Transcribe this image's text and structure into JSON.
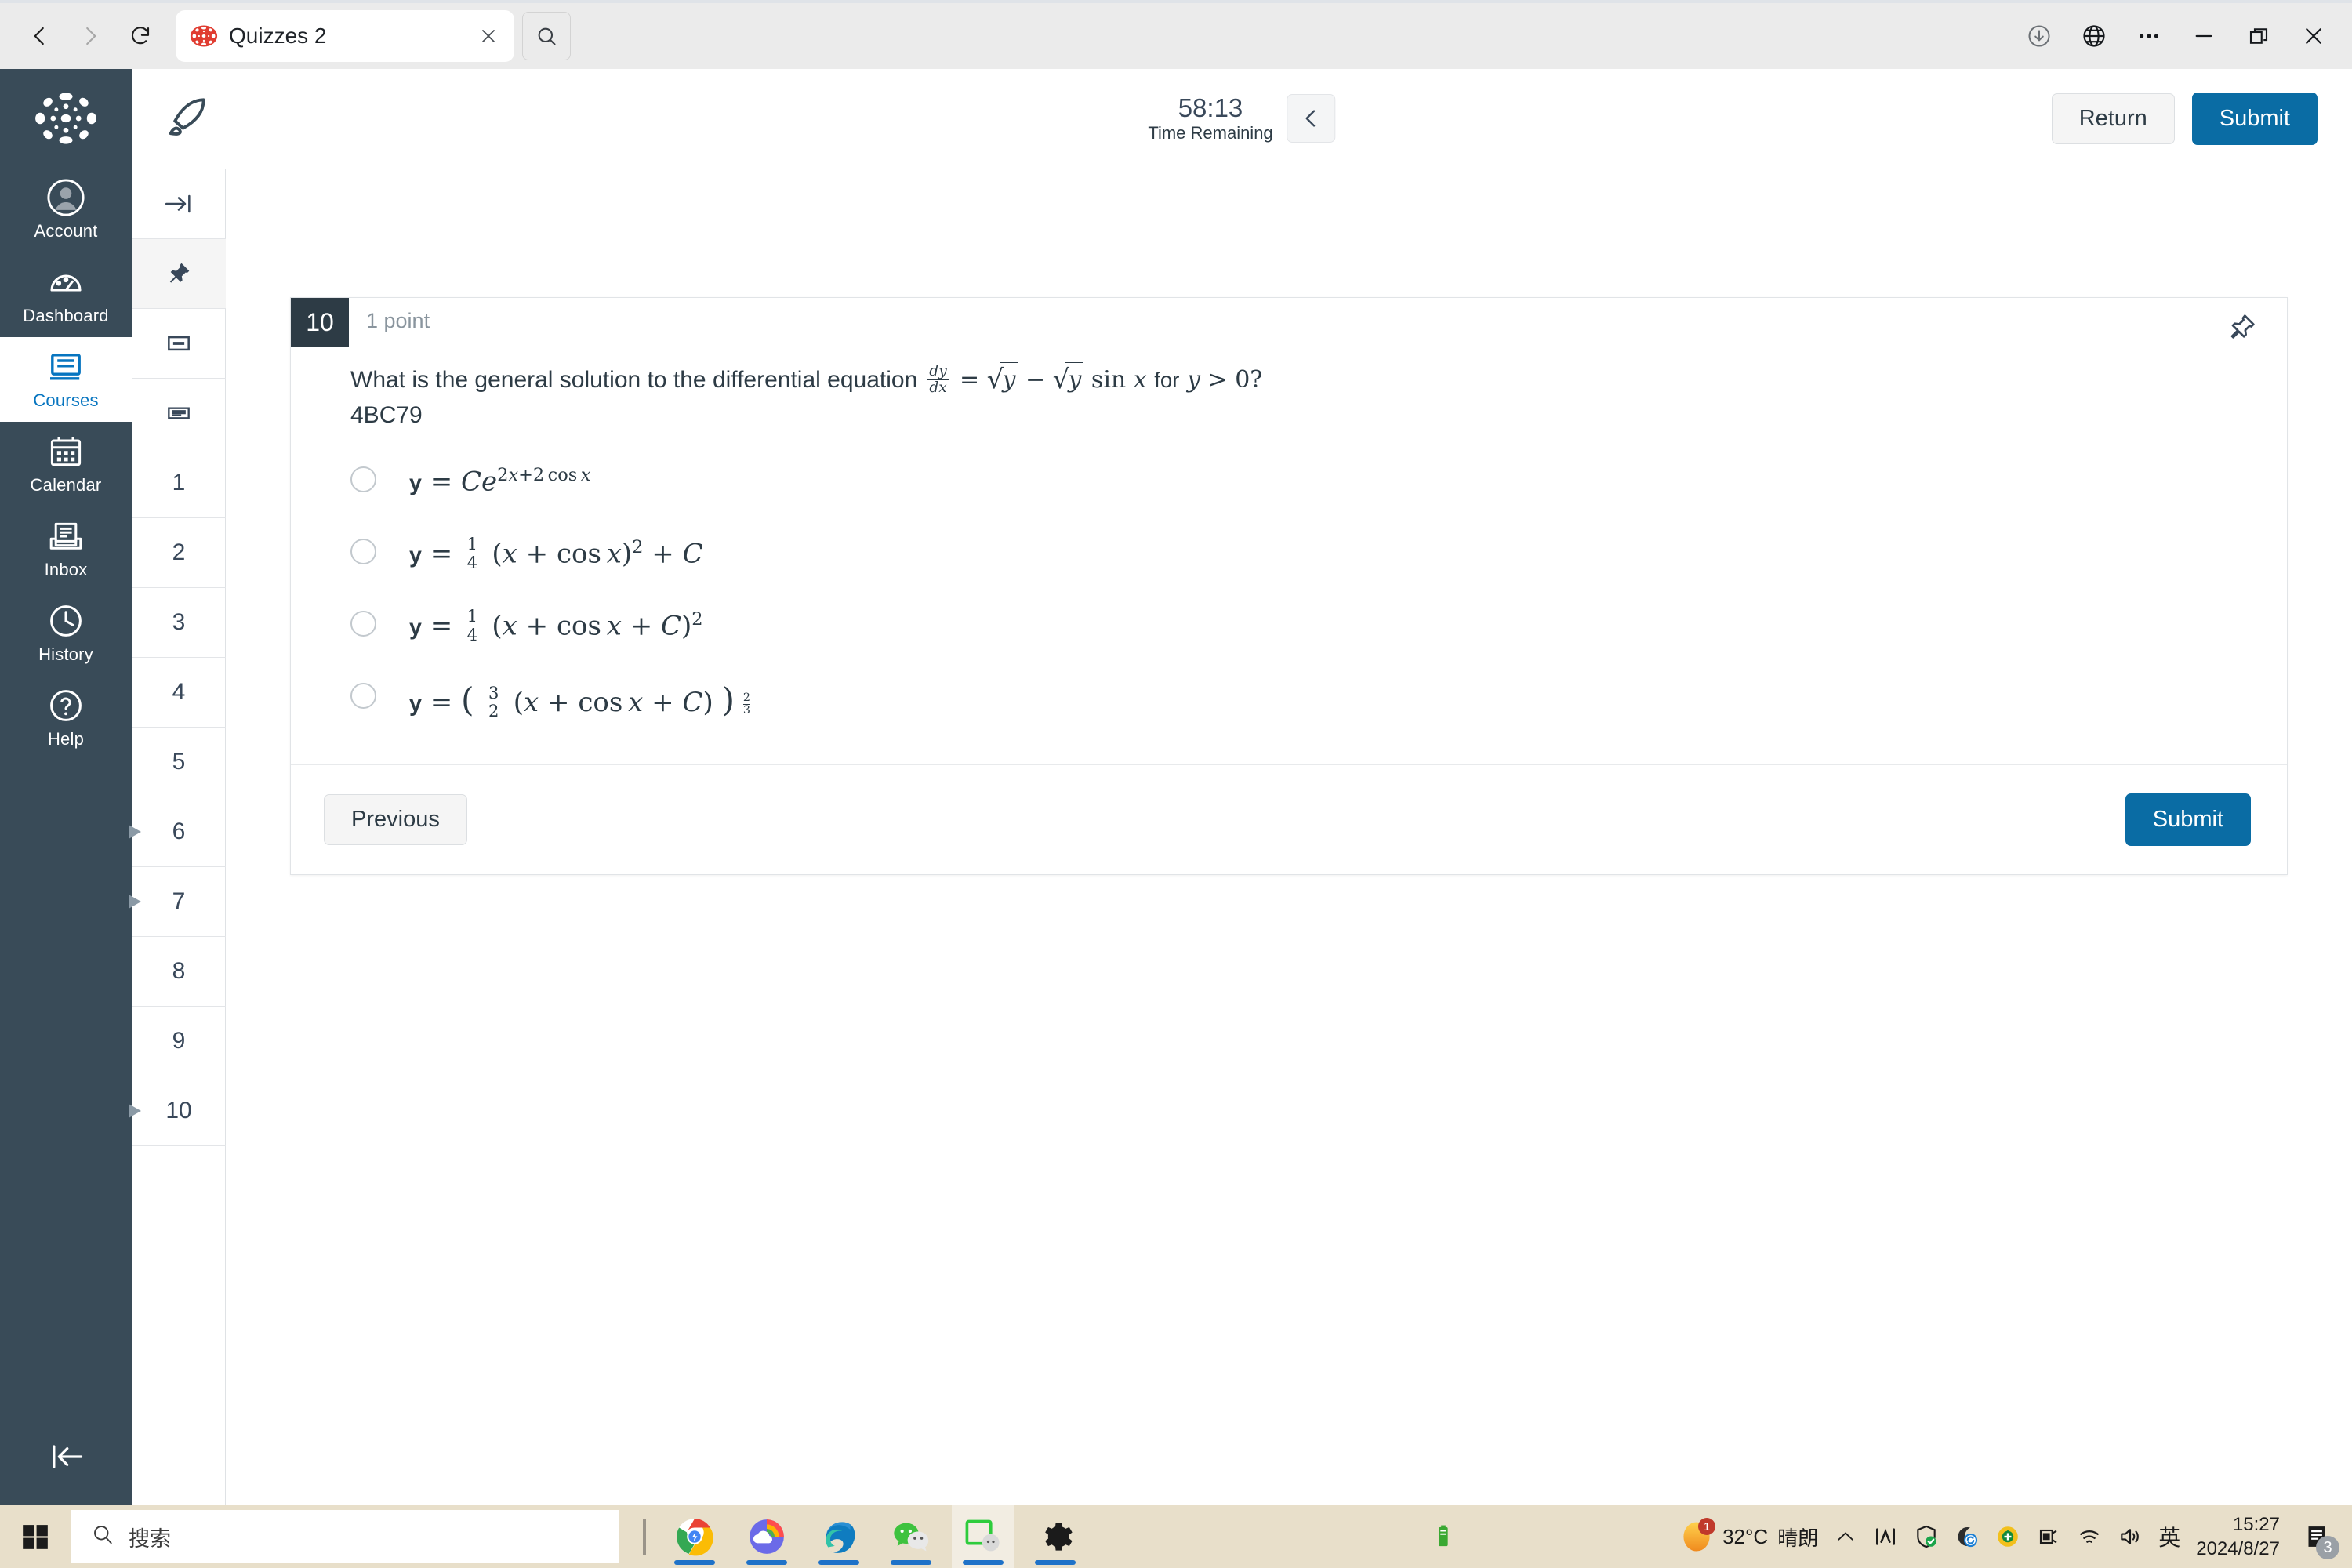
{
  "browser": {
    "back_icon": "back-chevron-icon",
    "forward_icon": "forward-chevron-icon",
    "reload_icon": "reload-icon",
    "tab": {
      "title": "Quizzes 2",
      "favicon": "canvas-logo-icon",
      "close_icon": "close-icon"
    },
    "tab_search_icon": "search-icon",
    "right_icons": [
      "download-icon",
      "globe-icon",
      "more-options-icon",
      "minimize-icon",
      "restore-icon",
      "close-window-icon"
    ]
  },
  "global_nav": {
    "logo": "canvas-logo",
    "items": [
      {
        "label": "Account",
        "icon": "user-avatar-icon",
        "active": false
      },
      {
        "label": "Dashboard",
        "icon": "dashboard-gauge-icon",
        "active": false
      },
      {
        "label": "Courses",
        "icon": "courses-book-icon",
        "active": true
      },
      {
        "label": "Calendar",
        "icon": "calendar-icon",
        "active": false
      },
      {
        "label": "Inbox",
        "icon": "inbox-tray-icon",
        "active": false
      },
      {
        "label": "History",
        "icon": "clock-icon",
        "active": false
      },
      {
        "label": "Help",
        "icon": "question-circle-icon",
        "active": false
      }
    ],
    "collapse_icon": "collapse-left-icon"
  },
  "quiz_header": {
    "rocket_icon": "rocket-icon",
    "timer_value": "58:13",
    "timer_label": "Time Remaining",
    "collapse_icon": "chevron-left-icon",
    "return_label": "Return",
    "submit_label": "Submit"
  },
  "question_rail": {
    "tool_icons": [
      "expand-right-icon",
      "pin-icon",
      "calculator-icon",
      "notes-icon"
    ],
    "questions": [
      {
        "label": "1",
        "flagged": false
      },
      {
        "label": "2",
        "flagged": false
      },
      {
        "label": "3",
        "flagged": false
      },
      {
        "label": "4",
        "flagged": false
      },
      {
        "label": "5",
        "flagged": false
      },
      {
        "label": "6",
        "flagged": true
      },
      {
        "label": "7",
        "flagged": true
      },
      {
        "label": "8",
        "flagged": false
      },
      {
        "label": "9",
        "flagged": false
      },
      {
        "label": "10",
        "flagged": true
      }
    ]
  },
  "question": {
    "number": "10",
    "points": "1 point",
    "pin_icon": "pin-icon",
    "stem_prefix": "What is the general solution to the differential equation",
    "stem_math": "dy/dx = √y − √y sin x for y > 0?",
    "code": "4BC79",
    "answers": [
      {
        "id": "a",
        "text": "y = Ce^(2x+2 cos x)",
        "selected": false
      },
      {
        "id": "b",
        "text": "y = 1/4 (x + cos x)^2 + C",
        "selected": false
      },
      {
        "id": "c",
        "text": "y = 1/4 (x + cos x + C)^2",
        "selected": false
      },
      {
        "id": "d",
        "text": "y = (3/2 (x + cos x + C))^(2/3)",
        "selected": false
      }
    ],
    "previous_label": "Previous",
    "submit_label": "Submit"
  },
  "taskbar": {
    "start_icon": "windows-start-icon",
    "search_placeholder": "搜索",
    "search_icon": "search-icon",
    "apps": [
      {
        "name": "chrome-icon",
        "active": false,
        "running": true
      },
      {
        "name": "onedrive-rainbow-icon",
        "active": false,
        "running": true
      },
      {
        "name": "edge-icon",
        "active": false,
        "running": true
      },
      {
        "name": "wechat-icon",
        "active": false,
        "running": true
      },
      {
        "name": "screenshot-tool-icon",
        "active": true,
        "running": true
      },
      {
        "name": "settings-gear-icon",
        "active": false,
        "running": true
      }
    ],
    "mid_icon": "battery-green-icon",
    "tray": {
      "weather_temp": "32°C",
      "weather_desc": "晴朗",
      "weather_badge": "1",
      "icons": [
        "chevron-up-icon",
        "network-meter-icon",
        "security-shield-icon",
        "sync-icon",
        "update-circle-icon",
        "plug-icon",
        "wifi-icon",
        "volume-icon"
      ],
      "ime_label": "英",
      "time": "15:27",
      "date": "2024/8/27",
      "notification_icon": "notifications-icon",
      "notification_count": "3"
    }
  },
  "colors": {
    "canvas_nav": "#394b58",
    "accent_blue": "#0a6ca4",
    "badge_dark": "#2d3b45",
    "taskbar": "#e8dfca"
  }
}
